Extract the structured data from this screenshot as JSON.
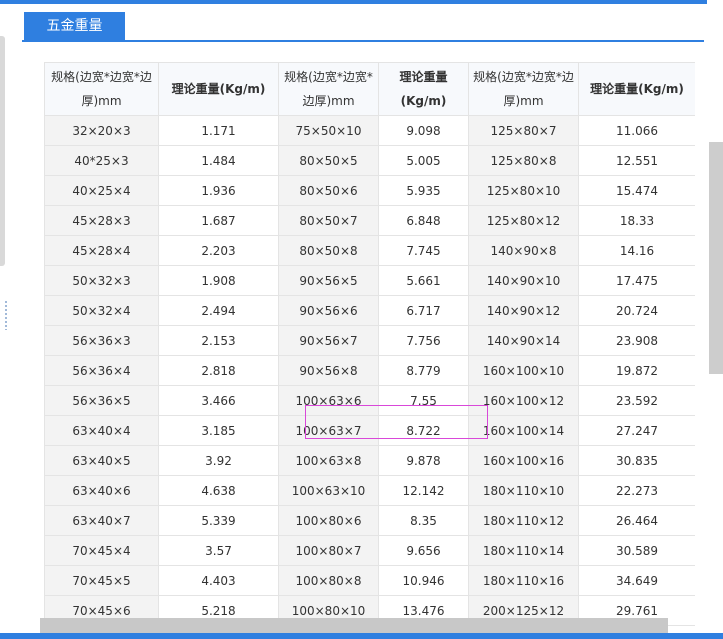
{
  "tab": {
    "label": "五金重量"
  },
  "table": {
    "headers": [
      "规格(边宽*边宽*边厚)mm",
      "理论重量(Kg/m)",
      "规格(边宽*边宽*边厚)mm",
      "理论重量(Kg/m)",
      "规格(边宽*边宽*边厚)mm",
      "理论重量(Kg/m)"
    ],
    "rows": [
      [
        "32×20×3",
        "1.171",
        "75×50×10",
        "9.098",
        "125×80×7",
        "11.066"
      ],
      [
        "40*25×3",
        "1.484",
        "80×50×5",
        "5.005",
        "125×80×8",
        "12.551"
      ],
      [
        "40×25×4",
        "1.936",
        "80×50×6",
        "5.935",
        "125×80×10",
        "15.474"
      ],
      [
        "45×28×3",
        "1.687",
        "80×50×7",
        "6.848",
        "125×80×12",
        "18.33"
      ],
      [
        "45×28×4",
        "2.203",
        "80×50×8",
        "7.745",
        "140×90×8",
        "14.16"
      ],
      [
        "50×32×3",
        "1.908",
        "90×56×5",
        "5.661",
        "140×90×10",
        "17.475"
      ],
      [
        "50×32×4",
        "2.494",
        "90×56×6",
        "6.717",
        "140×90×12",
        "20.724"
      ],
      [
        "56×36×3",
        "2.153",
        "90×56×7",
        "7.756",
        "140×90×14",
        "23.908"
      ],
      [
        "56×36×4",
        "2.818",
        "90×56×8",
        "8.779",
        "160×100×10",
        "19.872"
      ],
      [
        "56×36×5",
        "3.466",
        "100×63×6",
        "7.55",
        "160×100×12",
        "23.592"
      ],
      [
        "63×40×4",
        "3.185",
        "100×63×7",
        "8.722",
        "160×100×14",
        "27.247"
      ],
      [
        "63×40×5",
        "3.92",
        "100×63×8",
        "9.878",
        "160×100×16",
        "30.835"
      ],
      [
        "63×40×6",
        "4.638",
        "100×63×10",
        "12.142",
        "180×110×10",
        "22.273"
      ],
      [
        "63×40×7",
        "5.339",
        "100×80×6",
        "8.35",
        "180×110×12",
        "26.464"
      ],
      [
        "70×45×4",
        "3.57",
        "100×80×7",
        "9.656",
        "180×110×14",
        "30.589"
      ],
      [
        "70×45×5",
        "4.403",
        "100×80×8",
        "10.946",
        "180×110×16",
        "34.649"
      ],
      [
        "70×45×6",
        "5.218",
        "100×80×10",
        "13.476",
        "200×125×12",
        "29.761"
      ]
    ]
  }
}
